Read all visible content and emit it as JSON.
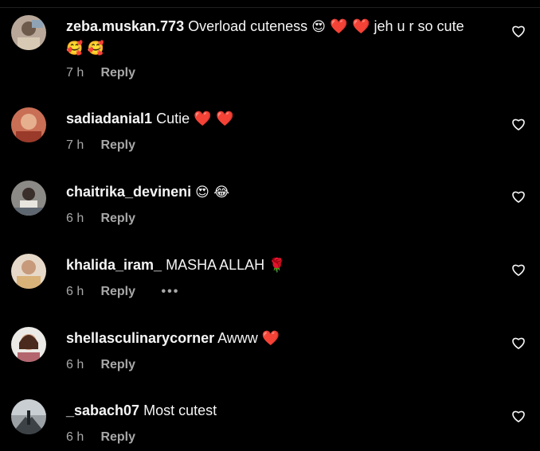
{
  "comments": [
    {
      "username": "zeba.muskan.773",
      "text": "Overload cuteness",
      "emoji_a": "😍",
      "hearts_a": "❤️ ❤️",
      "text2": "jeh u r so cute",
      "emoji_b": "🥰 🥰",
      "time": "7 h",
      "reply": "Reply"
    },
    {
      "username": "sadiadanial1",
      "text": "Cutie",
      "hearts": "❤️ ❤️",
      "time": "7 h",
      "reply": "Reply"
    },
    {
      "username": "chaitrika_devineni",
      "emoji": "😍 😂",
      "time": "6 h",
      "reply": "Reply"
    },
    {
      "username": "khalida_iram_",
      "text": "MASHA ALLAH",
      "emoji": "🌹",
      "time": "6 h",
      "reply": "Reply",
      "more": "•••"
    },
    {
      "username": "shellasculinarycorner",
      "text": "Awww",
      "hearts": "❤️",
      "time": "6 h",
      "reply": "Reply"
    },
    {
      "username": "_sabach07",
      "text": "Most cutest",
      "time": "6 h",
      "reply": "Reply"
    }
  ],
  "icons": {
    "like": "heart-outline-icon",
    "more": "more-options-icon"
  },
  "colors": {
    "background": "#000000",
    "text": "#f5f5f5",
    "muted": "#a8a8a8",
    "heart": "#ed1c2e"
  }
}
